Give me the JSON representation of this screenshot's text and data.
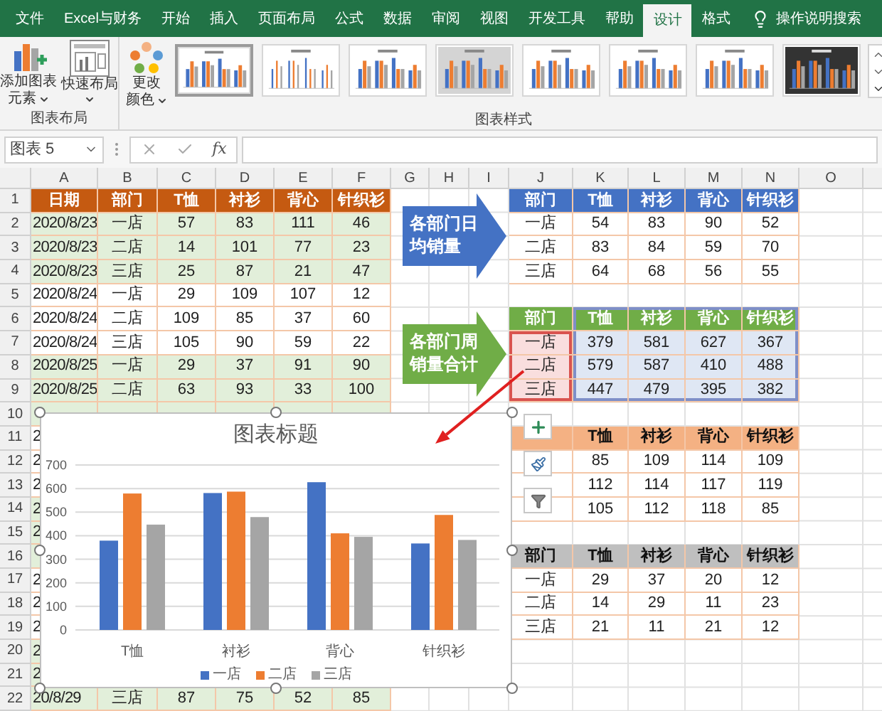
{
  "ribbon_tabs": [
    {
      "label": "文件",
      "selected": false
    },
    {
      "label": "Excel与财务",
      "selected": false
    },
    {
      "label": "开始",
      "selected": false
    },
    {
      "label": "插入",
      "selected": false
    },
    {
      "label": "页面布局",
      "selected": false
    },
    {
      "label": "公式",
      "selected": false
    },
    {
      "label": "数据",
      "selected": false
    },
    {
      "label": "审阅",
      "selected": false
    },
    {
      "label": "视图",
      "selected": false
    },
    {
      "label": "开发工具",
      "selected": false
    },
    {
      "label": "帮助",
      "selected": false
    },
    {
      "label": "设计",
      "selected": true
    },
    {
      "label": "格式",
      "selected": false
    }
  ],
  "tell_me": {
    "label": "操作说明搜索"
  },
  "ribbon": {
    "layout_group": {
      "label": "图表布局",
      "buttons": [
        {
          "kind": "add_element",
          "lines": [
            "添加图表",
            "元素"
          ],
          "dropdown": true
        },
        {
          "kind": "quick_layout",
          "lines": [
            "快速布局"
          ],
          "dropdown": true
        }
      ]
    },
    "style_group": {
      "label": "图表样式",
      "color_button": {
        "lines": [
          "更改",
          "颜色"
        ],
        "dropdown": true
      },
      "styles": [
        {
          "kind": "plain",
          "selected": true
        },
        {
          "kind": "thin",
          "selected": false
        },
        {
          "kind": "plain",
          "selected": false
        },
        {
          "kind": "gray",
          "selected": false
        },
        {
          "kind": "plain",
          "selected": false
        },
        {
          "kind": "plain",
          "selected": false
        },
        {
          "kind": "plain",
          "selected": false
        },
        {
          "kind": "dark",
          "selected": false
        }
      ]
    }
  },
  "formula_bar": {
    "name_box": "图表 5",
    "fx": "fx"
  },
  "sheet": {
    "columns": [
      "A",
      "B",
      "C",
      "D",
      "E",
      "F",
      "G",
      "H",
      "I",
      "J",
      "K",
      "L",
      "M",
      "N",
      "O"
    ],
    "rows": [
      "1",
      "2",
      "3",
      "4",
      "5",
      "6",
      "7",
      "8",
      "9",
      "10",
      "11",
      "12",
      "13",
      "14",
      "15",
      "16",
      "17",
      "18",
      "19",
      "20",
      "21",
      "22"
    ]
  },
  "tables": [
    {
      "color": "#c55a11",
      "header": [
        "日期",
        "部门",
        "T恤",
        "衬衫",
        "背心",
        "针织衫"
      ],
      "rows": [
        {
          "shaded": true,
          "cells": [
            "2020/8/23",
            "一店",
            "57",
            "83",
            "111",
            "46"
          ]
        },
        {
          "shaded": true,
          "cells": [
            "2020/8/23",
            "二店",
            "14",
            "101",
            "77",
            "23"
          ]
        },
        {
          "shaded": true,
          "cells": [
            "2020/8/23",
            "三店",
            "25",
            "87",
            "21",
            "47"
          ]
        },
        {
          "shaded": false,
          "cells": [
            "2020/8/24",
            "一店",
            "29",
            "109",
            "107",
            "12"
          ]
        },
        {
          "shaded": false,
          "cells": [
            "2020/8/24",
            "二店",
            "109",
            "85",
            "37",
            "60"
          ]
        },
        {
          "shaded": false,
          "cells": [
            "2020/8/24",
            "三店",
            "105",
            "90",
            "59",
            "22"
          ]
        },
        {
          "shaded": true,
          "cells": [
            "2020/8/25",
            "一店",
            "29",
            "37",
            "91",
            "90"
          ]
        },
        {
          "shaded": true,
          "cells": [
            "2020/8/25",
            "二店",
            "63",
            "93",
            "33",
            "100"
          ]
        },
        {
          "shaded": true
        },
        {
          "shaded": false,
          "cells": [
            "2"
          ]
        },
        {
          "shaded": false,
          "cells": [
            "2"
          ]
        },
        {
          "shaded": false,
          "cells": [
            "2"
          ]
        },
        {
          "shaded": true,
          "cells": [
            "2"
          ]
        },
        {
          "shaded": true,
          "cells": [
            "2"
          ]
        },
        {
          "shaded": true
        },
        {
          "shaded": false,
          "cells": [
            "2"
          ]
        },
        {
          "shaded": false,
          "cells": [
            "2"
          ]
        },
        {
          "shaded": false,
          "cells": [
            "2"
          ]
        },
        {
          "shaded": true,
          "cells": [
            "2"
          ]
        },
        {
          "shaded": true,
          "cells": [
            "2"
          ]
        },
        {
          "shaded": true,
          "cells": [
            "20/8/29",
            "三店",
            "87",
            "75",
            "52",
            "85"
          ]
        }
      ]
    },
    {
      "color": "#4472c4",
      "header": [
        "部门",
        "T恤",
        "衬衫",
        "背心",
        "针织衫"
      ],
      "rows": [
        {
          "cells": [
            "一店",
            "54",
            "83",
            "90",
            "52"
          ]
        },
        {
          "cells": [
            "二店",
            "83",
            "84",
            "59",
            "70"
          ]
        },
        {
          "cells": [
            "三店",
            "64",
            "68",
            "56",
            "55"
          ]
        }
      ]
    },
    {
      "color": "#70ad47",
      "highlighted": true,
      "header": [
        "部门",
        "T恤",
        "衬衫",
        "背心",
        "针织衫"
      ],
      "rows": [
        {
          "cells": [
            "一店",
            "379",
            "581",
            "627",
            "367"
          ]
        },
        {
          "cells": [
            "二店",
            "579",
            "587",
            "410",
            "488"
          ]
        },
        {
          "cells": [
            "三店",
            "447",
            "479",
            "395",
            "382"
          ]
        }
      ]
    },
    {
      "color": "#f4b183",
      "header": [
        "T恤",
        "衬衫",
        "背心",
        "针织衫"
      ],
      "rows": [
        {
          "cells": [
            "85",
            "109",
            "114",
            "109"
          ]
        },
        {
          "cells": [
            "112",
            "114",
            "117",
            "119"
          ]
        },
        {
          "cells": [
            "105",
            "112",
            "118",
            "85"
          ]
        }
      ]
    },
    {
      "color": "#bfbfbf",
      "header": [
        "部门",
        "T恤",
        "衬衫",
        "背心",
        "针织衫"
      ],
      "rows": [
        {
          "cells": [
            "一店",
            "29",
            "37",
            "20",
            "12"
          ]
        },
        {
          "cells": [
            "二店",
            "14",
            "29",
            "11",
            "23"
          ]
        },
        {
          "cells": [
            "三店",
            "21",
            "11",
            "21",
            "12"
          ]
        }
      ]
    }
  ],
  "callouts": [
    {
      "text": "各部门日均销量",
      "color": "#4472c4"
    },
    {
      "text": "各部门周销量合计",
      "color": "#70ad47"
    }
  ],
  "chart": {
    "selected": true,
    "chart_data": {
      "type": "bar",
      "title": "图表标题",
      "categories": [
        "T恤",
        "衬衫",
        "背心",
        "针织衫"
      ],
      "series": [
        {
          "name": "一店",
          "color": "#4472c4",
          "values": [
            379,
            581,
            627,
            367
          ]
        },
        {
          "name": "二店",
          "color": "#ed7d31",
          "values": [
            579,
            587,
            410,
            488
          ]
        },
        {
          "name": "三店",
          "color": "#a5a5a5",
          "values": [
            447,
            479,
            395,
            382
          ]
        }
      ],
      "grid": true,
      "legend": true,
      "ylim": [
        0,
        700
      ],
      "yticks": [
        0,
        100,
        200,
        300,
        400,
        500,
        600,
        700
      ]
    }
  }
}
